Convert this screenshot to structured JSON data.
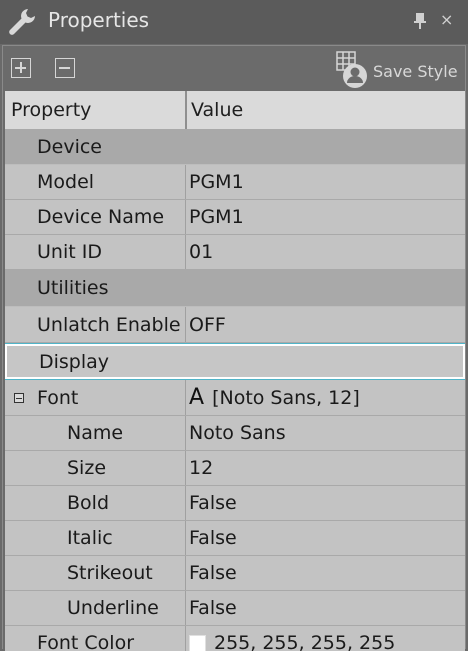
{
  "window": {
    "title": "Properties",
    "icons": {
      "title": "wrench-icon",
      "pin": "pin-icon",
      "close": "close-icon"
    }
  },
  "toolbar": {
    "expand_icon": "plus-box-icon",
    "collapse_icon": "minus-box-icon",
    "save_style_label": "Save Style",
    "save_style_icon": "save-style-icon"
  },
  "table": {
    "headers": {
      "property": "Property",
      "value": "Value"
    },
    "rows": [
      {
        "type": "category",
        "label": "Device"
      },
      {
        "type": "item",
        "label": "Model",
        "value": "PGM1"
      },
      {
        "type": "item",
        "label": "Device Name",
        "value": "PGM1"
      },
      {
        "type": "item",
        "label": "Unit ID",
        "value": "01"
      },
      {
        "type": "category",
        "label": "Utilities"
      },
      {
        "type": "item",
        "label": "Unlatch Enable",
        "value": "OFF"
      },
      {
        "type": "category",
        "label": "Display",
        "selected": true
      },
      {
        "type": "group",
        "label": "Font",
        "glyph": "A",
        "value": "[Noto Sans, 12]",
        "expanded": true
      },
      {
        "type": "sub",
        "label": "Name",
        "value": "Noto Sans"
      },
      {
        "type": "sub",
        "label": "Size",
        "value": "12"
      },
      {
        "type": "sub",
        "label": "Bold",
        "value": "False"
      },
      {
        "type": "sub",
        "label": "Italic",
        "value": "False"
      },
      {
        "type": "sub",
        "label": "Strikeout",
        "value": "False"
      },
      {
        "type": "sub",
        "label": "Underline",
        "value": "False"
      },
      {
        "type": "item",
        "label": "Font Color",
        "value": "255, 255, 255, 255",
        "swatch": "#ffffff"
      }
    ]
  },
  "colors": {
    "window_bg": "#5b5b5b",
    "category_bg": "#a9a9a9",
    "row_bg": "#c3c3c3",
    "selection_outline": "#4fb4c8"
  }
}
